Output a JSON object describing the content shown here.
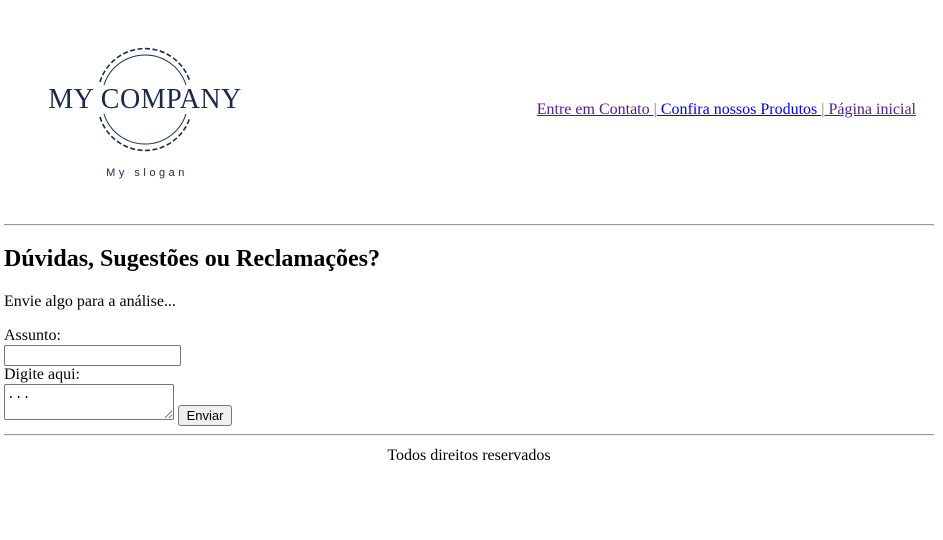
{
  "header": {
    "logo": {
      "company_name": "MY COMPANY",
      "slogan": "My slogan",
      "color": "#1b2a4a"
    },
    "nav": {
      "separator": "|",
      "links": [
        {
          "label": "Entre em Contato "
        },
        {
          "label": " Confira nossos Produtos "
        },
        {
          "label": " Página inicial"
        }
      ]
    }
  },
  "main": {
    "title": "Dúvidas, Sugestões ou Reclamações?",
    "intro": "Envie algo para a análise...",
    "form": {
      "subject_label": "Assunto:",
      "subject_value": "",
      "message_label": "Digite aqui:",
      "message_placeholder": "...",
      "submit_label": "Enviar"
    }
  },
  "footer": {
    "text": "Todos direitos reservados"
  }
}
